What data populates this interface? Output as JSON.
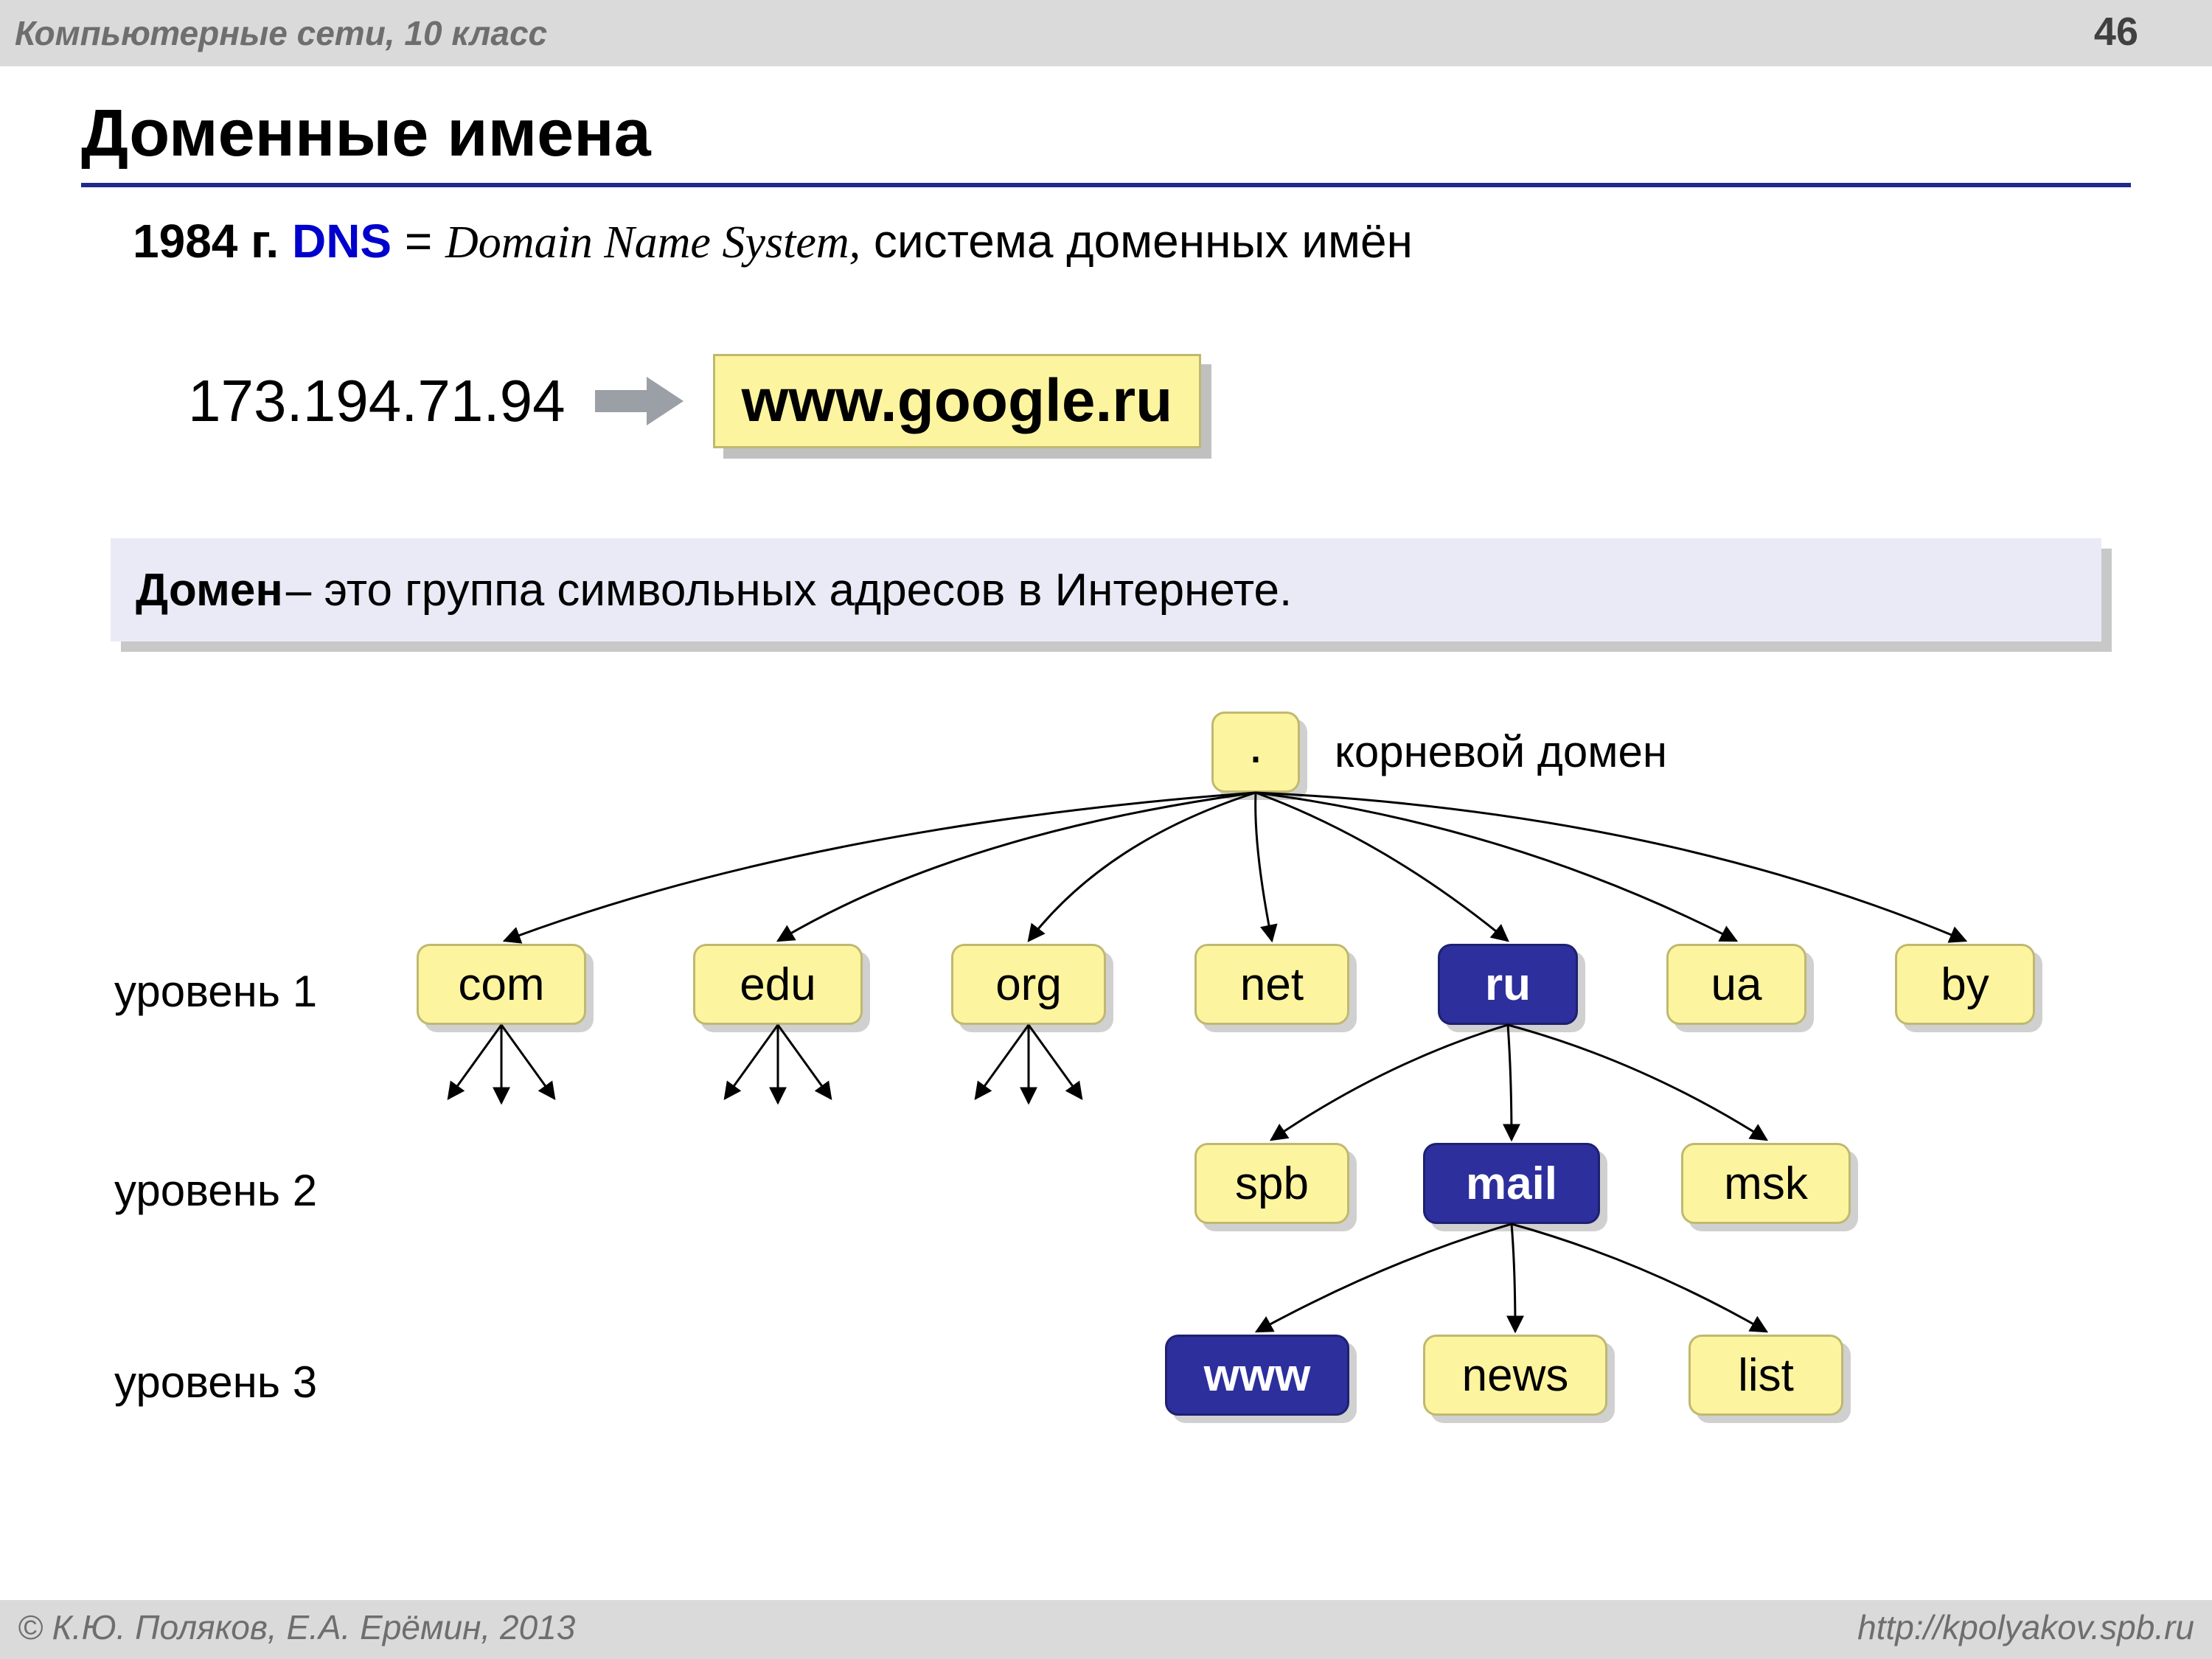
{
  "header": {
    "course": "Компьютерные сети, 10 класс",
    "page": "46"
  },
  "title": "Доменные имена",
  "intro": {
    "year": "1984 г. ",
    "dns": "DNS",
    "eq": " = ",
    "full": "Domain Name System,",
    "rest": " система доменных имён"
  },
  "iprow": {
    "ip": "173.194.71.94",
    "domain": "www.google.ru"
  },
  "def": {
    "term": "Домен",
    "text": " – это группа символьных адресов в Интернете."
  },
  "tree": {
    "root": ".",
    "root_label": "корневой домен",
    "level_labels": [
      "уровень 1",
      "уровень 2",
      "уровень 3"
    ],
    "l1": [
      "com",
      "edu",
      "org",
      "net",
      "ru",
      "ua",
      "by"
    ],
    "l2": [
      "spb",
      "mail",
      "msk"
    ],
    "l3": [
      "www",
      "news",
      "list"
    ],
    "emph_l1": "ru",
    "emph_l2": "mail",
    "emph_l3": "www"
  },
  "footer": {
    "left": "© К.Ю. Поляков, Е.А. Ерёмин, 2013",
    "right": "http://kpolyakov.spb.ru"
  }
}
